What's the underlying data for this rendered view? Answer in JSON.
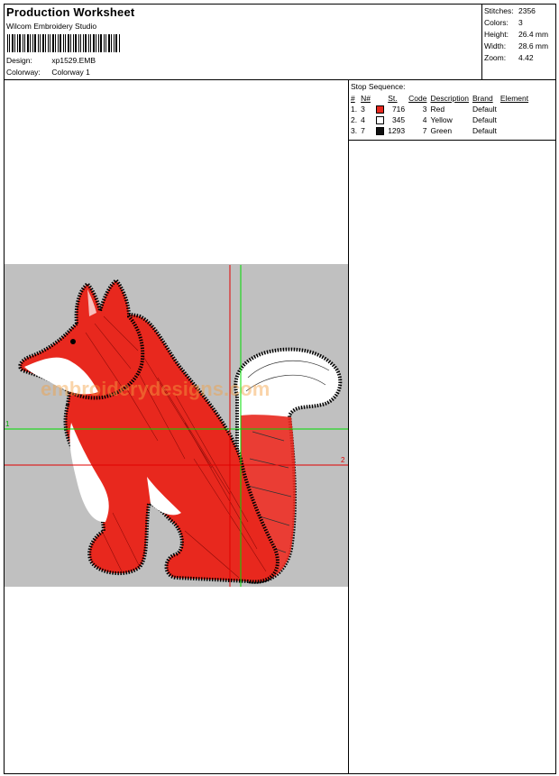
{
  "header": {
    "title": "Production Worksheet",
    "software": "Wilcom Embroidery Studio",
    "design_label": "Design:",
    "design_value": "xp1529.EMB",
    "colorway_label": "Colorway:",
    "colorway_value": "Colorway 1"
  },
  "stats": [
    {
      "label": "Stitches:",
      "value": "2356"
    },
    {
      "label": "Colors:",
      "value": "3"
    },
    {
      "label": "Height:",
      "value": "26.4 mm"
    },
    {
      "label": "Width:",
      "value": "28.6 mm"
    },
    {
      "label": "Zoom:",
      "value": "4.42"
    }
  ],
  "stop_sequence": {
    "title": "Stop Sequence:",
    "columns": [
      "#",
      "N#",
      "St.",
      "Code",
      "Description",
      "Brand",
      "Element"
    ],
    "rows": [
      {
        "index": "1.",
        "n": "3",
        "color": "#e8281e",
        "stitches": "716",
        "code": "3",
        "description": "Red",
        "brand": "Default",
        "element": ""
      },
      {
        "index": "2.",
        "n": "4",
        "color": "#ffffff",
        "stitches": "345",
        "code": "4",
        "description": "Yellow",
        "brand": "Default",
        "element": ""
      },
      {
        "index": "3.",
        "n": "7",
        "color": "#111111",
        "stitches": "1293",
        "code": "7",
        "description": "Green",
        "brand": "Default",
        "element": ""
      }
    ]
  },
  "canvas": {
    "watermark": "embroiderydesigns.com",
    "axis_label_1": "1",
    "axis_label_2": "2",
    "background_color": "#c0c0c0",
    "red_axis_color": "#e00000",
    "green_axis_color": "#00dd00"
  }
}
